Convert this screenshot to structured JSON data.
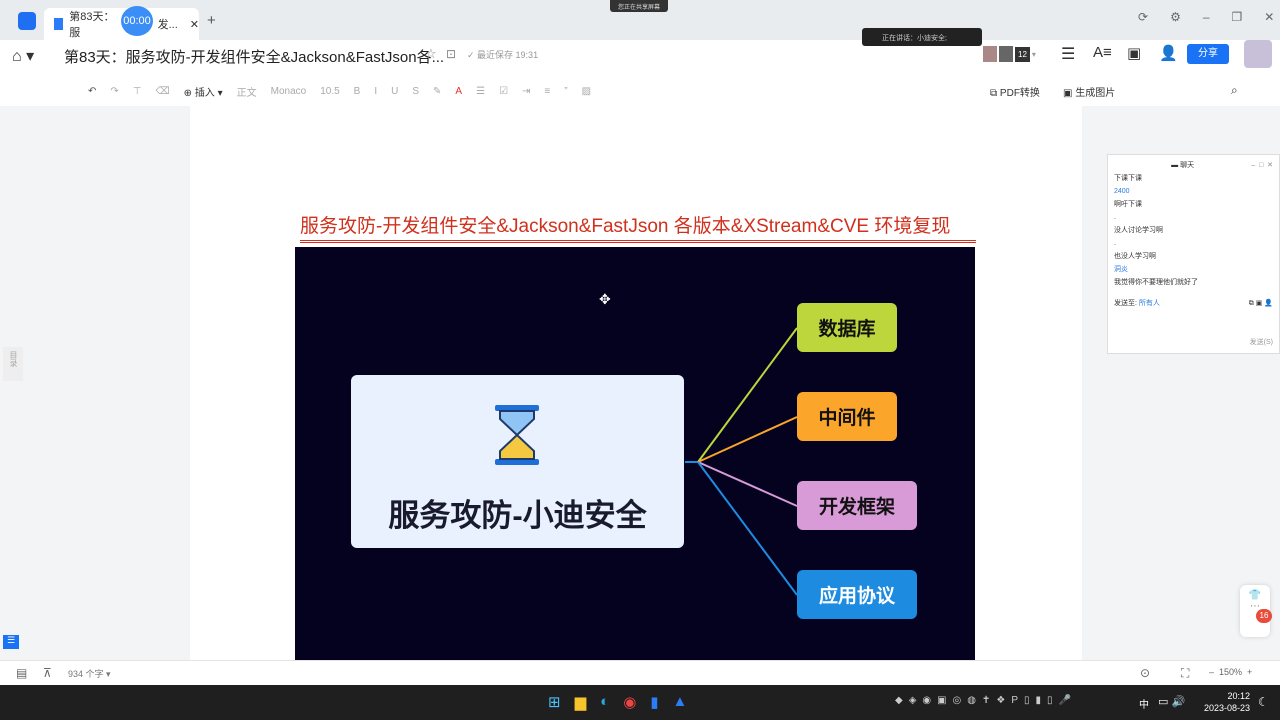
{
  "tab": {
    "title": "第83天：服",
    "suffix": "发...",
    "timer": "00:00"
  },
  "sharing_notice": "您正在共享屏幕",
  "speaking_notice": "正在讲话：小迪安全;",
  "doc": {
    "title": "第83天：服务攻防-开发组件安全&Jackson&FastJson各...",
    "saved": "最近保存 19:31",
    "participants": "12",
    "share": "分享"
  },
  "toolbar": {
    "insert": "插入",
    "style": "正文",
    "font": "Monaco",
    "size": "10.5",
    "pdf": "PDF转换",
    "gen_image": "生成图片"
  },
  "content": {
    "heading": "服务攻防-开发组件安全&Jackson&FastJson 各版本&XStream&CVE 环境复现",
    "center": "服务攻防-小迪安全",
    "nodes": [
      {
        "label": "数据库",
        "color": "#bcd63b"
      },
      {
        "label": "中间件",
        "color": "#fba62a"
      },
      {
        "label": "开发框架",
        "color": "#d99ad8"
      },
      {
        "label": "应用协议",
        "color": "#1c8be0"
      }
    ]
  },
  "chat": {
    "title": "聊天",
    "messages": [
      "下课下课",
      "2400",
      "啊吁下课",
      ".",
      "没人讨论学习啊",
      ".",
      "也没人学习啊",
      "洞炎",
      "我觉得你不要理他们就好了"
    ],
    "send_to_label": "发送至:",
    "send_to": "所有人",
    "send": "发送(S)"
  },
  "side": {
    "outline": "目录",
    "badge": "16"
  },
  "statusbar": {
    "word_count": "934 个字",
    "zoom": "150%"
  },
  "taskbar": {
    "time": "20:12",
    "date": "2023-08-23",
    "ime": "中"
  }
}
